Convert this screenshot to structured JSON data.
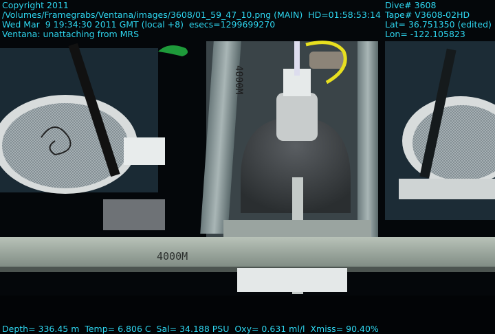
{
  "overlay": {
    "top_left": [
      "Copyright 2011",
      "/Volumes/Framegrabs/Ventana/images/3608/01_59_47_10.png (MAIN)  HD=01:58:53:14",
      "Wed Mar  9 19:34:30 2011 GMT (local +8)  esecs=1299699270",
      "Ventana: unattaching from MRS"
    ],
    "top_right": [
      "Dive# 3608",
      "Tape# V3608-02HD",
      "Lat= 36.751350 (edited)",
      "Lon= -122.105823"
    ],
    "bottom": "Depth= 336.45 m  Temp= 6.806 C  Sal= 34.188 PSU  Oxy= 0.631 ml/l  Xmiss= 90.40%"
  },
  "scene": {
    "stamp_center": "4000M",
    "stamp_bottom": "4000M",
    "colors": {
      "overlay_text": "#2fd8f2",
      "water": "#05080c",
      "metal": "#8a9898",
      "rope": "#e8e020",
      "handle": "#1e9a3a"
    }
  }
}
